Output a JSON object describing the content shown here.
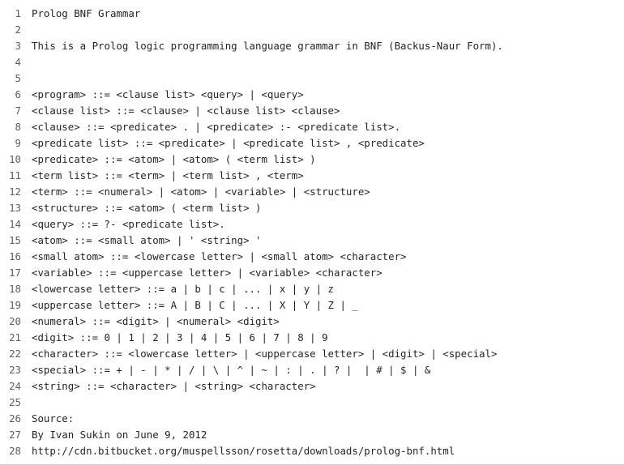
{
  "file": {
    "lines": [
      "Prolog BNF Grammar",
      "",
      "This is a Prolog logic programming language grammar in BNF (Backus-Naur Form).",
      "",
      "",
      "<program> ::= <clause list> <query> | <query>",
      "<clause list> ::= <clause> | <clause list> <clause>",
      "<clause> ::= <predicate> . | <predicate> :- <predicate list>.",
      "<predicate list> ::= <predicate> | <predicate list> , <predicate>",
      "<predicate> ::= <atom> | <atom> ( <term list> )",
      "<term list> ::= <term> | <term list> , <term>",
      "<term> ::= <numeral> | <atom> | <variable> | <structure>",
      "<structure> ::= <atom> ( <term list> )",
      "<query> ::= ?- <predicate list>.",
      "<atom> ::= <small atom> | ' <string> '",
      "<small atom> ::= <lowercase letter> | <small atom> <character>",
      "<variable> ::= <uppercase letter> | <variable> <character>",
      "<lowercase letter> ::= a | b | c | ... | x | y | z",
      "<uppercase letter> ::= A | B | C | ... | X | Y | Z | _",
      "<numeral> ::= <digit> | <numeral> <digit>",
      "<digit> ::= 0 | 1 | 2 | 3 | 4 | 5 | 6 | 7 | 8 | 9",
      "<character> ::= <lowercase letter> | <uppercase letter> | <digit> | <special>",
      "<special> ::= + | - | * | / | \\ | ^ | ~ | : | . | ? |  | # | $ | &",
      "<string> ::= <character> | <string> <character>",
      "",
      "Source:",
      "By Ivan Sukin on June 9, 2012",
      "http://cdn.bitbucket.org/muspellsson/rosetta/downloads/prolog-bnf.html"
    ]
  }
}
